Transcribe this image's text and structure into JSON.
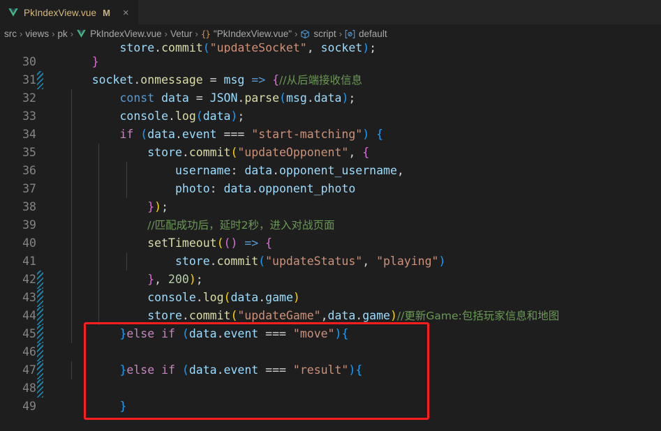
{
  "window": {
    "app": "Visual Studio Code",
    "theme_colors": {
      "editor_background": "#1e1e1e",
      "tabbar_background": "#252526",
      "line_number": "#858585",
      "annotation_red": "#ff1e1e",
      "diff_marker_blue": "#1b81a8"
    }
  },
  "tab": {
    "icon": "vue-file-icon",
    "label": "PkIndexView.vue",
    "dirty_badge": "M",
    "close_label": "×"
  },
  "breadcrumb": {
    "items": [
      {
        "icon": null,
        "text": "src"
      },
      {
        "icon": null,
        "text": "views"
      },
      {
        "icon": null,
        "text": "pk"
      },
      {
        "icon": "vue-file-icon",
        "text": "PkIndexView.vue"
      },
      {
        "icon": null,
        "text": "Vetur"
      },
      {
        "icon": "braces-icon",
        "text": "\"PkIndexView.vue\""
      },
      {
        "icon": "cube-icon",
        "text": "script"
      },
      {
        "icon": "symbol-default-icon",
        "text": "default"
      }
    ],
    "separator": "›"
  },
  "editor": {
    "first_partial_line": {
      "tokens": [
        {
          "t": "        ",
          "c": "t-plain"
        },
        {
          "t": "store",
          "c": "t-var"
        },
        {
          "t": ".",
          "c": "t-plain"
        },
        {
          "t": "commit",
          "c": "t-fn"
        },
        {
          "t": "(",
          "c": "t-p3"
        },
        {
          "t": "\"updateSocket\"",
          "c": "t-str"
        },
        {
          "t": ", ",
          "c": "t-plain"
        },
        {
          "t": "socket",
          "c": "t-var"
        },
        {
          "t": ")",
          "c": "t-p3"
        },
        {
          "t": ";",
          "c": "t-plain"
        }
      ]
    },
    "lines": [
      {
        "number": "30",
        "changed": false,
        "guides": [],
        "tokens": [
          {
            "t": "    ",
            "c": "t-plain"
          },
          {
            "t": "}",
            "c": "t-p2"
          }
        ]
      },
      {
        "number": "31",
        "changed": true,
        "guides": [],
        "tokens": [
          {
            "t": "    ",
            "c": "t-plain"
          },
          {
            "t": "socket",
            "c": "t-var"
          },
          {
            "t": ".",
            "c": "t-plain"
          },
          {
            "t": "onmessage",
            "c": "t-fn"
          },
          {
            "t": " = ",
            "c": "t-plain"
          },
          {
            "t": "msg",
            "c": "t-var"
          },
          {
            "t": " ",
            "c": "t-plain"
          },
          {
            "t": "=>",
            "c": "t-kw2"
          },
          {
            "t": " ",
            "c": "t-plain"
          },
          {
            "t": "{",
            "c": "t-p2"
          },
          {
            "t": "//从后端接收信息",
            "c": "t-com"
          }
        ]
      },
      {
        "number": "32",
        "changed": false,
        "guides": [
          1
        ],
        "tokens": [
          {
            "t": "        ",
            "c": "t-plain"
          },
          {
            "t": "const",
            "c": "t-kw2"
          },
          {
            "t": " ",
            "c": "t-plain"
          },
          {
            "t": "data",
            "c": "t-var"
          },
          {
            "t": " = ",
            "c": "t-plain"
          },
          {
            "t": "JSON",
            "c": "t-var"
          },
          {
            "t": ".",
            "c": "t-plain"
          },
          {
            "t": "parse",
            "c": "t-fn"
          },
          {
            "t": "(",
            "c": "t-p3"
          },
          {
            "t": "msg",
            "c": "t-var"
          },
          {
            "t": ".",
            "c": "t-plain"
          },
          {
            "t": "data",
            "c": "t-var"
          },
          {
            "t": ")",
            "c": "t-p3"
          },
          {
            "t": ";",
            "c": "t-plain"
          }
        ]
      },
      {
        "number": "33",
        "changed": false,
        "guides": [
          1
        ],
        "tokens": [
          {
            "t": "        ",
            "c": "t-plain"
          },
          {
            "t": "console",
            "c": "t-var"
          },
          {
            "t": ".",
            "c": "t-plain"
          },
          {
            "t": "log",
            "c": "t-fn"
          },
          {
            "t": "(",
            "c": "t-p3"
          },
          {
            "t": "data",
            "c": "t-var"
          },
          {
            "t": ")",
            "c": "t-p3"
          },
          {
            "t": ";",
            "c": "t-plain"
          }
        ]
      },
      {
        "number": "34",
        "changed": false,
        "guides": [
          1
        ],
        "tokens": [
          {
            "t": "        ",
            "c": "t-plain"
          },
          {
            "t": "if",
            "c": "t-kw"
          },
          {
            "t": " ",
            "c": "t-plain"
          },
          {
            "t": "(",
            "c": "t-p3"
          },
          {
            "t": "data",
            "c": "t-var"
          },
          {
            "t": ".",
            "c": "t-plain"
          },
          {
            "t": "event",
            "c": "t-var"
          },
          {
            "t": " === ",
            "c": "t-plain"
          },
          {
            "t": "\"start-matching\"",
            "c": "t-str"
          },
          {
            "t": ")",
            "c": "t-p3"
          },
          {
            "t": " ",
            "c": "t-plain"
          },
          {
            "t": "{",
            "c": "t-p3"
          }
        ]
      },
      {
        "number": "35",
        "changed": false,
        "guides": [
          1,
          2
        ],
        "tokens": [
          {
            "t": "            ",
            "c": "t-plain"
          },
          {
            "t": "store",
            "c": "t-var"
          },
          {
            "t": ".",
            "c": "t-plain"
          },
          {
            "t": "commit",
            "c": "t-fn"
          },
          {
            "t": "(",
            "c": "t-p1"
          },
          {
            "t": "\"updateOpponent\"",
            "c": "t-str"
          },
          {
            "t": ", ",
            "c": "t-plain"
          },
          {
            "t": "{",
            "c": "t-p2"
          }
        ]
      },
      {
        "number": "36",
        "changed": false,
        "guides": [
          1,
          2,
          3
        ],
        "tokens": [
          {
            "t": "                ",
            "c": "t-plain"
          },
          {
            "t": "username",
            "c": "t-var"
          },
          {
            "t": ": ",
            "c": "t-plain"
          },
          {
            "t": "data",
            "c": "t-var"
          },
          {
            "t": ".",
            "c": "t-plain"
          },
          {
            "t": "opponent_username",
            "c": "t-var"
          },
          {
            "t": ",",
            "c": "t-plain"
          }
        ]
      },
      {
        "number": "37",
        "changed": false,
        "guides": [
          1,
          2,
          3
        ],
        "tokens": [
          {
            "t": "                ",
            "c": "t-plain"
          },
          {
            "t": "photo",
            "c": "t-var"
          },
          {
            "t": ": ",
            "c": "t-plain"
          },
          {
            "t": "data",
            "c": "t-var"
          },
          {
            "t": ".",
            "c": "t-plain"
          },
          {
            "t": "opponent_photo",
            "c": "t-var"
          }
        ]
      },
      {
        "number": "38",
        "changed": false,
        "guides": [
          1,
          2
        ],
        "tokens": [
          {
            "t": "            ",
            "c": "t-plain"
          },
          {
            "t": "}",
            "c": "t-p2"
          },
          {
            "t": ")",
            "c": "t-p1"
          },
          {
            "t": ";",
            "c": "t-plain"
          }
        ]
      },
      {
        "number": "39",
        "changed": false,
        "guides": [
          1,
          2
        ],
        "tokens": [
          {
            "t": "            ",
            "c": "t-plain"
          },
          {
            "t": "//匹配成功后，延时2秒，进入对战页面",
            "c": "t-com"
          }
        ]
      },
      {
        "number": "40",
        "changed": false,
        "guides": [
          1,
          2
        ],
        "tokens": [
          {
            "t": "            ",
            "c": "t-plain"
          },
          {
            "t": "setTimeout",
            "c": "t-fn"
          },
          {
            "t": "(",
            "c": "t-p1"
          },
          {
            "t": "(",
            "c": "t-p2"
          },
          {
            "t": ")",
            "c": "t-p2"
          },
          {
            "t": " ",
            "c": "t-plain"
          },
          {
            "t": "=>",
            "c": "t-kw2"
          },
          {
            "t": " ",
            "c": "t-plain"
          },
          {
            "t": "{",
            "c": "t-p2"
          }
        ]
      },
      {
        "number": "41",
        "changed": false,
        "guides": [
          1,
          2,
          3
        ],
        "tokens": [
          {
            "t": "                ",
            "c": "t-plain"
          },
          {
            "t": "store",
            "c": "t-var"
          },
          {
            "t": ".",
            "c": "t-plain"
          },
          {
            "t": "commit",
            "c": "t-fn"
          },
          {
            "t": "(",
            "c": "t-p3"
          },
          {
            "t": "\"updateStatus\"",
            "c": "t-str"
          },
          {
            "t": ", ",
            "c": "t-plain"
          },
          {
            "t": "\"playing\"",
            "c": "t-str"
          },
          {
            "t": ")",
            "c": "t-p3"
          }
        ]
      },
      {
        "number": "42",
        "changed": true,
        "guides": [
          1,
          2
        ],
        "tokens": [
          {
            "t": "            ",
            "c": "t-plain"
          },
          {
            "t": "}",
            "c": "t-p2"
          },
          {
            "t": ", ",
            "c": "t-plain"
          },
          {
            "t": "200",
            "c": "t-num"
          },
          {
            "t": ")",
            "c": "t-p1"
          },
          {
            "t": ";",
            "c": "t-plain"
          }
        ]
      },
      {
        "number": "43",
        "changed": true,
        "guides": [
          1,
          2
        ],
        "tokens": [
          {
            "t": "            ",
            "c": "t-plain"
          },
          {
            "t": "console",
            "c": "t-var"
          },
          {
            "t": ".",
            "c": "t-plain"
          },
          {
            "t": "log",
            "c": "t-fn"
          },
          {
            "t": "(",
            "c": "t-p1"
          },
          {
            "t": "data",
            "c": "t-var"
          },
          {
            "t": ".",
            "c": "t-plain"
          },
          {
            "t": "game",
            "c": "t-var"
          },
          {
            "t": ")",
            "c": "t-p1"
          }
        ]
      },
      {
        "number": "44",
        "changed": true,
        "guides": [
          1,
          2
        ],
        "tokens": [
          {
            "t": "            ",
            "c": "t-plain"
          },
          {
            "t": "store",
            "c": "t-var"
          },
          {
            "t": ".",
            "c": "t-plain"
          },
          {
            "t": "commit",
            "c": "t-fn"
          },
          {
            "t": "(",
            "c": "t-p1"
          },
          {
            "t": "\"updateGame\"",
            "c": "t-str"
          },
          {
            "t": ",",
            "c": "t-plain"
          },
          {
            "t": "data",
            "c": "t-var"
          },
          {
            "t": ".",
            "c": "t-plain"
          },
          {
            "t": "game",
            "c": "t-var"
          },
          {
            "t": ")",
            "c": "t-p1"
          },
          {
            "t": "//更新Game:包括玩家信息和地图",
            "c": "t-com"
          }
        ]
      },
      {
        "number": "45",
        "changed": true,
        "guides": [
          1
        ],
        "tokens": [
          {
            "t": "        ",
            "c": "t-plain"
          },
          {
            "t": "}",
            "c": "t-p3"
          },
          {
            "t": "else",
            "c": "t-kw"
          },
          {
            "t": " ",
            "c": "t-plain"
          },
          {
            "t": "if",
            "c": "t-kw"
          },
          {
            "t": " ",
            "c": "t-plain"
          },
          {
            "t": "(",
            "c": "t-p3"
          },
          {
            "t": "data",
            "c": "t-var"
          },
          {
            "t": ".",
            "c": "t-plain"
          },
          {
            "t": "event",
            "c": "t-var"
          },
          {
            "t": " === ",
            "c": "t-plain"
          },
          {
            "t": "\"move\"",
            "c": "t-str"
          },
          {
            "t": ")",
            "c": "t-p3"
          },
          {
            "t": "{",
            "c": "t-p3"
          }
        ]
      },
      {
        "number": "46",
        "changed": true,
        "guides": [],
        "tokens": []
      },
      {
        "number": "47",
        "changed": true,
        "guides": [
          1
        ],
        "tokens": [
          {
            "t": "        ",
            "c": "t-plain"
          },
          {
            "t": "}",
            "c": "t-p3"
          },
          {
            "t": "else",
            "c": "t-kw"
          },
          {
            "t": " ",
            "c": "t-plain"
          },
          {
            "t": "if",
            "c": "t-kw"
          },
          {
            "t": " ",
            "c": "t-plain"
          },
          {
            "t": "(",
            "c": "t-p3"
          },
          {
            "t": "data",
            "c": "t-var"
          },
          {
            "t": ".",
            "c": "t-plain"
          },
          {
            "t": "event",
            "c": "t-var"
          },
          {
            "t": " === ",
            "c": "t-plain"
          },
          {
            "t": "\"result\"",
            "c": "t-str"
          },
          {
            "t": ")",
            "c": "t-p3"
          },
          {
            "t": "{",
            "c": "t-p3"
          }
        ]
      },
      {
        "number": "48",
        "changed": true,
        "guides": [],
        "tokens": []
      },
      {
        "number": "49",
        "changed": false,
        "guides": [],
        "tokens": [
          {
            "t": "        ",
            "c": "t-plain"
          },
          {
            "t": "}",
            "c": "t-p3"
          }
        ]
      }
    ],
    "annotation": {
      "shape": "rectangle",
      "color": "#ff1e1e",
      "covers_lines": [
        "45",
        "46",
        "47",
        "48",
        "49"
      ]
    }
  }
}
